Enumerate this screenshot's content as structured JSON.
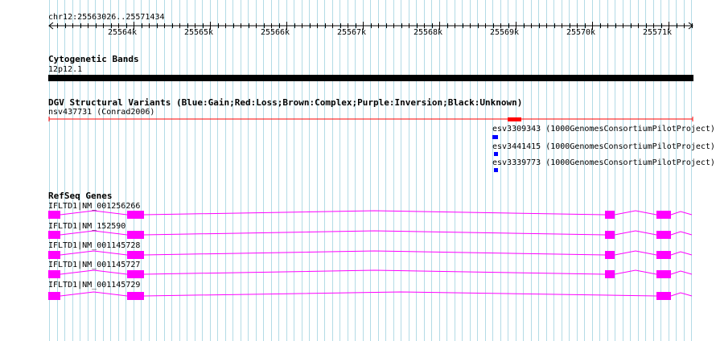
{
  "ruler": {
    "region": "chr12:25563026..25571434",
    "ticks": [
      "25564k",
      "25565k",
      "25566k",
      "25567k",
      "25568k",
      "25569k",
      "25570k",
      "25571k"
    ]
  },
  "cytobands": {
    "title": "Cytogenetic Bands",
    "band_label": "12p12.1",
    "band_color": "#000000"
  },
  "dgv": {
    "title": "DGV Structural Variants (Blue:Gain;Red:Loss;Brown:Complex;Purple:Inversion;Black:Unknown)",
    "features": [
      {
        "label": "nsv437731 (Conrad2006)",
        "color": "#ff0000"
      },
      {
        "label": "esv3309343 (1000GenomesConsortiumPilotProject)",
        "color": "#0000ff"
      },
      {
        "label": "esv3441415 (1000GenomesConsortiumPilotProject)",
        "color": "#0000ff"
      },
      {
        "label": "esv3339773 (1000GenomesConsortiumPilotProject)",
        "color": "#0000ff"
      }
    ]
  },
  "refseq": {
    "title": "RefSeq Genes",
    "gene_color": "#ff00ff",
    "transcripts": [
      {
        "label": "IFLTD1|NM_001256266"
      },
      {
        "label": "IFLTD1|NM_152590"
      },
      {
        "label": "IFLTD1|NM_001145728"
      },
      {
        "label": "IFLTD1|NM_001145727"
      },
      {
        "label": "IFLTD1|NM_001145729"
      }
    ]
  }
}
